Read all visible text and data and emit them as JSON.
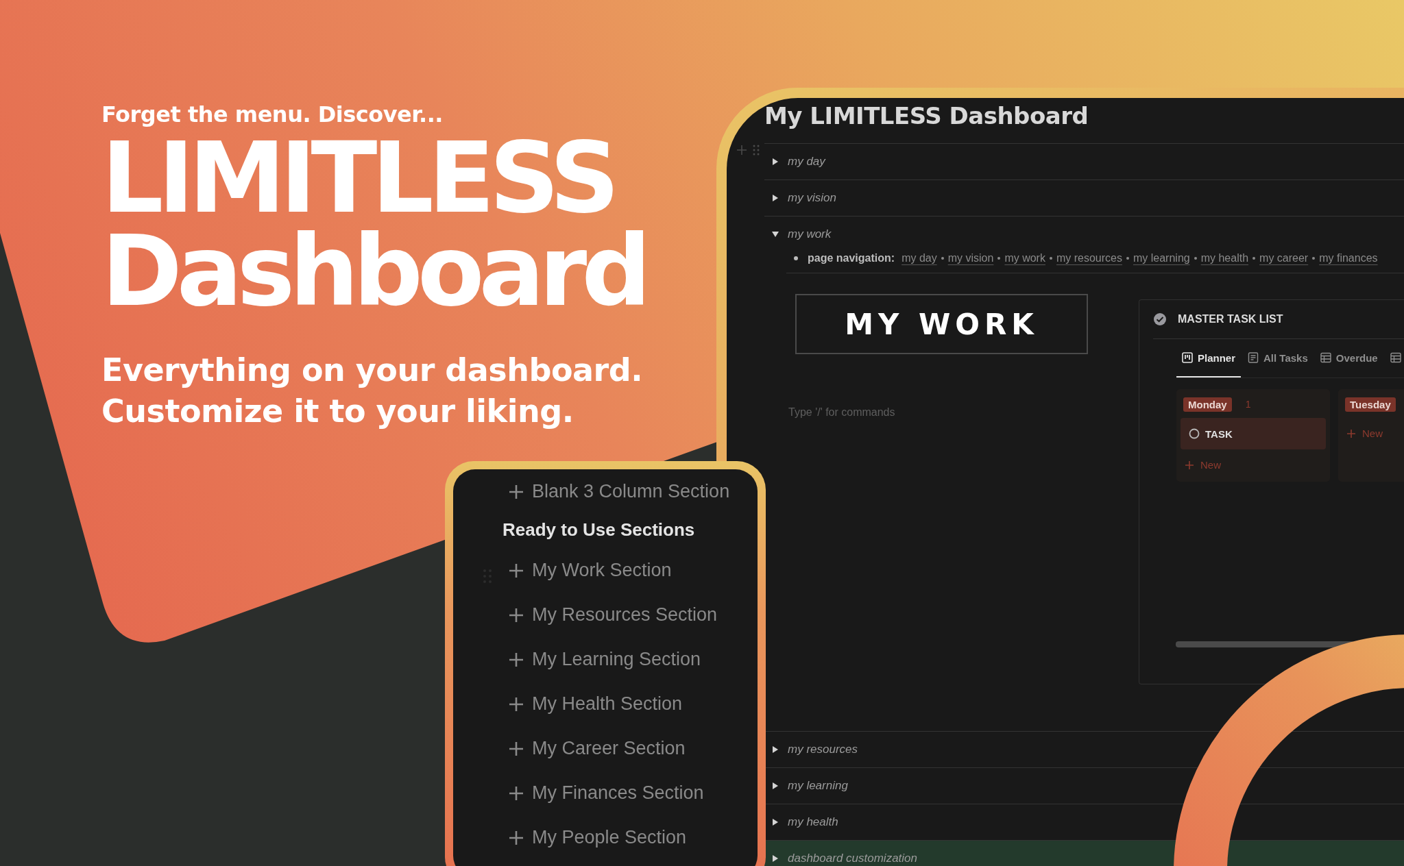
{
  "hero": {
    "kicker": "Forget the menu. Discover...",
    "title_lines": [
      "LIMITLESS",
      "Dashboard"
    ],
    "subtitle_lines": [
      "Everything on your dashboard.",
      "Customize it to your liking."
    ]
  },
  "sections_menu": {
    "items": [
      {
        "kind": "add",
        "label": "Blank 3 Column Section"
      },
      {
        "kind": "heading",
        "label": "Ready to Use Sections"
      },
      {
        "kind": "add",
        "label": "My Work Section"
      },
      {
        "kind": "add",
        "label": "My Resources Section"
      },
      {
        "kind": "add",
        "label": "My Learning Section"
      },
      {
        "kind": "add",
        "label": "My Health Section"
      },
      {
        "kind": "add",
        "label": "My Career Section"
      },
      {
        "kind": "add",
        "label": "My Finances Section"
      },
      {
        "kind": "add",
        "label": "My People Section"
      }
    ]
  },
  "dashboard": {
    "title": "My LIMITLESS Dashboard",
    "toggles_top": [
      {
        "label": "my day",
        "expanded": false
      },
      {
        "label": "my vision",
        "expanded": false
      },
      {
        "label": "my work",
        "expanded": true
      }
    ],
    "page_navigation": {
      "label": "page navigation:",
      "links": [
        "my day",
        "my vision",
        "my work",
        "my resources",
        "my learning",
        "my health",
        "my career",
        "my finances"
      ]
    },
    "banner": "MY WORK",
    "placeholder": "Type '/' for commands",
    "task_list": {
      "title": "MASTER TASK LIST",
      "tabs": [
        {
          "label": "Planner",
          "kind": "board",
          "selected": true
        },
        {
          "label": "All Tasks",
          "kind": "list",
          "selected": false
        },
        {
          "label": "Overdue",
          "kind": "table",
          "selected": false
        },
        {
          "kind": "table",
          "selected": false
        }
      ],
      "groups": [
        {
          "label": "Monday",
          "count": "1",
          "cards": [
            "TASK"
          ],
          "new": "New"
        },
        {
          "label": "Tuesday",
          "new": "New"
        }
      ]
    },
    "toggles_bottom": [
      {
        "label": "my resources",
        "expanded": false,
        "highlighted": false
      },
      {
        "label": "my learning",
        "expanded": false,
        "highlighted": false
      },
      {
        "label": "my health",
        "expanded": false,
        "highlighted": false
      },
      {
        "label": "dashboard customization",
        "expanded": false,
        "highlighted": true
      }
    ]
  }
}
